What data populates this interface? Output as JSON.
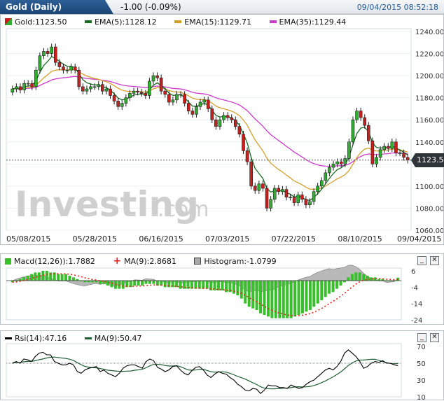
{
  "header": {
    "title": "Gold (Daily)",
    "change": "-1.00 (-0.09%)",
    "datetime": "09/04/2015 08:52:18"
  },
  "main": {
    "legend": {
      "gold": "Gold:1123.50",
      "ema5": "EMA(5):1128.12",
      "ema15": "EMA(15):1129.71",
      "ema35": "EMA(35):1129.44"
    },
    "watermark": "Investing",
    "watermark_suffix": ".com",
    "current_price": "1123.50",
    "y_ticks": [
      "1240.00",
      "1220.00",
      "1200.00",
      "1180.00",
      "1160.00",
      "1140.00",
      "1120.00",
      "1100.00",
      "1080.00",
      "1060.00"
    ],
    "x_ticks": [
      "05/08/2015",
      "05/28/2015",
      "06/16/2015",
      "07/03/2015",
      "07/22/2015",
      "08/10/2015",
      "09/04/2015"
    ],
    "colors": {
      "up": "#2fae2f",
      "down": "#c81e1e",
      "ema5": "#1b6b22",
      "ema15": "#d4a02a",
      "ema35": "#cc3ccc"
    }
  },
  "macd": {
    "legend": {
      "macd": "Macd(12,26)):1.7882",
      "ma": "MA(9):2.8681",
      "histogram": "Histogram:-1.0799"
    },
    "y_ticks": [
      "6",
      "-4",
      "-14",
      "-24"
    ]
  },
  "rsi": {
    "legend": {
      "rsi": "Rsi(14):47.16",
      "ma": "MA(9):50.47"
    },
    "y_ticks": [
      "70",
      "50",
      "30",
      "10"
    ]
  },
  "controls": {
    "minimize": "_",
    "close": "✕"
  },
  "chart_data": [
    {
      "type": "candlestick",
      "title": "Gold (Daily)",
      "ylim": [
        1060,
        1240
      ],
      "x_ticks": [
        "05/08/2015",
        "05/28/2015",
        "06/16/2015",
        "07/03/2015",
        "07/22/2015",
        "08/10/2015",
        "09/04/2015"
      ],
      "close": [
        1188,
        1190,
        1187,
        1193,
        1193,
        1190,
        1205,
        1218,
        1222,
        1220,
        1226,
        1212,
        1208,
        1205,
        1205,
        1208,
        1205,
        1190,
        1186,
        1188,
        1190,
        1190,
        1192,
        1186,
        1188,
        1182,
        1177,
        1172,
        1175,
        1180,
        1184,
        1186,
        1185,
        1184,
        1182,
        1195,
        1200,
        1198,
        1186,
        1183,
        1176,
        1178,
        1183,
        1183,
        1175,
        1168,
        1165,
        1172,
        1176,
        1178,
        1170,
        1160,
        1154,
        1160,
        1164,
        1162,
        1160,
        1154,
        1147,
        1132,
        1122,
        1100,
        1096,
        1102,
        1098,
        1080,
        1088,
        1098,
        1095,
        1097,
        1090,
        1090,
        1085,
        1092,
        1088,
        1083,
        1086,
        1095,
        1100,
        1105,
        1112,
        1117,
        1120,
        1122,
        1120,
        1125,
        1140,
        1160,
        1168,
        1162,
        1155,
        1141,
        1120,
        1126,
        1133,
        1136,
        1134,
        1140,
        1130,
        1130,
        1126,
        1123.5
      ],
      "ema5": 1128.12,
      "ema15": 1129.71,
      "ema35": 1129.44,
      "last": 1123.5
    },
    {
      "type": "bar",
      "title": "Macd(12,26))",
      "ylim": [
        -24,
        6
      ],
      "series": [
        {
          "name": "Macd(12,26))",
          "values": [
            -1,
            0,
            1,
            2,
            3,
            4,
            5,
            5,
            6,
            6,
            5,
            5,
            4,
            4,
            4,
            3,
            2,
            1,
            0,
            -1,
            -1,
            -1,
            -1,
            -2,
            -2,
            -3,
            -4,
            -5,
            -5,
            -5,
            -4,
            -4,
            -3,
            -3,
            -3,
            -2,
            -2,
            -2,
            -3,
            -3,
            -4,
            -4,
            -4,
            -4,
            -5,
            -5,
            -5,
            -5,
            -5,
            -5,
            -5,
            -5,
            -6,
            -6,
            -6,
            -6,
            -7,
            -7,
            -8,
            -9,
            -11,
            -14,
            -16,
            -17,
            -18,
            -20,
            -21,
            -22,
            -23,
            -23,
            -23,
            -23,
            -23,
            -23,
            -22,
            -21,
            -20,
            -19,
            -18,
            -16,
            -14,
            -12,
            -10,
            -8,
            -7,
            -5,
            -3,
            -1,
            2,
            4,
            5,
            5,
            4,
            3,
            2,
            2,
            1,
            1,
            0,
            0,
            0,
            1.7882
          ]
        },
        {
          "name": "MA(9)",
          "values": 2.8681
        },
        {
          "name": "Histogram",
          "values": -1.0799
        }
      ]
    },
    {
      "type": "line",
      "title": "Rsi(14)",
      "ylim": [
        10,
        70
      ],
      "series": [
        {
          "name": "Rsi(14)",
          "values": [
            50,
            52,
            50,
            55,
            54,
            52,
            58,
            62,
            63,
            60,
            60,
            52,
            50,
            48,
            48,
            50,
            48,
            40,
            38,
            42,
            44,
            45,
            46,
            40,
            42,
            38,
            36,
            34,
            38,
            44,
            47,
            48,
            48,
            46,
            44,
            52,
            55,
            53,
            45,
            43,
            40,
            42,
            46,
            47,
            42,
            38,
            36,
            41,
            45,
            46,
            42,
            36,
            33,
            37,
            40,
            38,
            37,
            33,
            30,
            25,
            22,
            18,
            17,
            20,
            19,
            14,
            18,
            24,
            23,
            23,
            21,
            21,
            20,
            24,
            22,
            20,
            21,
            25,
            28,
            30,
            34,
            38,
            42,
            44,
            42,
            46,
            52,
            62,
            66,
            62,
            58,
            52,
            44,
            46,
            50,
            52,
            51,
            53,
            50,
            50,
            48,
            47.16
          ]
        },
        {
          "name": "MA(9)",
          "values": 50.47
        }
      ]
    }
  ]
}
